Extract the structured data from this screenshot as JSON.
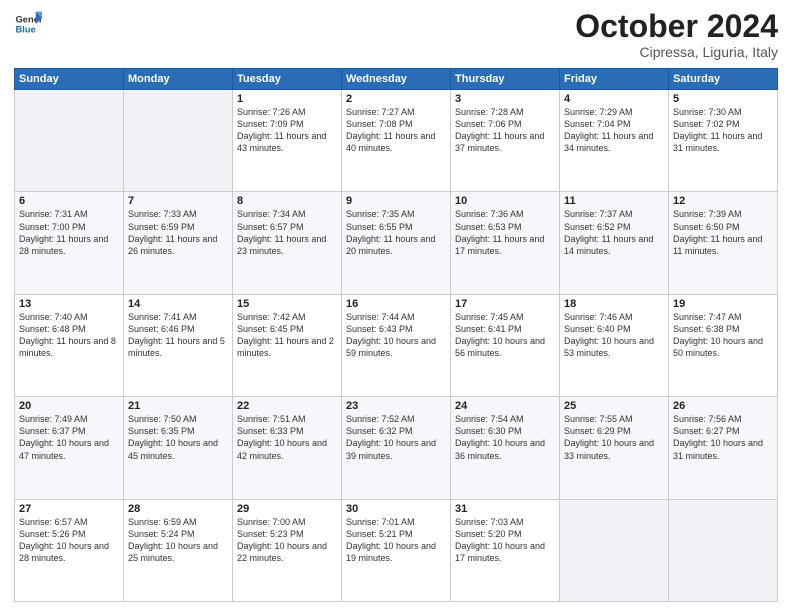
{
  "logo": {
    "line1": "General",
    "line2": "Blue"
  },
  "title": "October 2024",
  "subtitle": "Cipressa, Liguria, Italy",
  "header_days": [
    "Sunday",
    "Monday",
    "Tuesday",
    "Wednesday",
    "Thursday",
    "Friday",
    "Saturday"
  ],
  "weeks": [
    [
      {
        "day": "",
        "content": ""
      },
      {
        "day": "",
        "content": ""
      },
      {
        "day": "1",
        "content": "Sunrise: 7:26 AM\nSunset: 7:09 PM\nDaylight: 11 hours and 43 minutes."
      },
      {
        "day": "2",
        "content": "Sunrise: 7:27 AM\nSunset: 7:08 PM\nDaylight: 11 hours and 40 minutes."
      },
      {
        "day": "3",
        "content": "Sunrise: 7:28 AM\nSunset: 7:06 PM\nDaylight: 11 hours and 37 minutes."
      },
      {
        "day": "4",
        "content": "Sunrise: 7:29 AM\nSunset: 7:04 PM\nDaylight: 11 hours and 34 minutes."
      },
      {
        "day": "5",
        "content": "Sunrise: 7:30 AM\nSunset: 7:02 PM\nDaylight: 11 hours and 31 minutes."
      }
    ],
    [
      {
        "day": "6",
        "content": "Sunrise: 7:31 AM\nSunset: 7:00 PM\nDaylight: 11 hours and 28 minutes."
      },
      {
        "day": "7",
        "content": "Sunrise: 7:33 AM\nSunset: 6:59 PM\nDaylight: 11 hours and 26 minutes."
      },
      {
        "day": "8",
        "content": "Sunrise: 7:34 AM\nSunset: 6:57 PM\nDaylight: 11 hours and 23 minutes."
      },
      {
        "day": "9",
        "content": "Sunrise: 7:35 AM\nSunset: 6:55 PM\nDaylight: 11 hours and 20 minutes."
      },
      {
        "day": "10",
        "content": "Sunrise: 7:36 AM\nSunset: 6:53 PM\nDaylight: 11 hours and 17 minutes."
      },
      {
        "day": "11",
        "content": "Sunrise: 7:37 AM\nSunset: 6:52 PM\nDaylight: 11 hours and 14 minutes."
      },
      {
        "day": "12",
        "content": "Sunrise: 7:39 AM\nSunset: 6:50 PM\nDaylight: 11 hours and 11 minutes."
      }
    ],
    [
      {
        "day": "13",
        "content": "Sunrise: 7:40 AM\nSunset: 6:48 PM\nDaylight: 11 hours and 8 minutes."
      },
      {
        "day": "14",
        "content": "Sunrise: 7:41 AM\nSunset: 6:46 PM\nDaylight: 11 hours and 5 minutes."
      },
      {
        "day": "15",
        "content": "Sunrise: 7:42 AM\nSunset: 6:45 PM\nDaylight: 11 hours and 2 minutes."
      },
      {
        "day": "16",
        "content": "Sunrise: 7:44 AM\nSunset: 6:43 PM\nDaylight: 10 hours and 59 minutes."
      },
      {
        "day": "17",
        "content": "Sunrise: 7:45 AM\nSunset: 6:41 PM\nDaylight: 10 hours and 56 minutes."
      },
      {
        "day": "18",
        "content": "Sunrise: 7:46 AM\nSunset: 6:40 PM\nDaylight: 10 hours and 53 minutes."
      },
      {
        "day": "19",
        "content": "Sunrise: 7:47 AM\nSunset: 6:38 PM\nDaylight: 10 hours and 50 minutes."
      }
    ],
    [
      {
        "day": "20",
        "content": "Sunrise: 7:49 AM\nSunset: 6:37 PM\nDaylight: 10 hours and 47 minutes."
      },
      {
        "day": "21",
        "content": "Sunrise: 7:50 AM\nSunset: 6:35 PM\nDaylight: 10 hours and 45 minutes."
      },
      {
        "day": "22",
        "content": "Sunrise: 7:51 AM\nSunset: 6:33 PM\nDaylight: 10 hours and 42 minutes."
      },
      {
        "day": "23",
        "content": "Sunrise: 7:52 AM\nSunset: 6:32 PM\nDaylight: 10 hours and 39 minutes."
      },
      {
        "day": "24",
        "content": "Sunrise: 7:54 AM\nSunset: 6:30 PM\nDaylight: 10 hours and 36 minutes."
      },
      {
        "day": "25",
        "content": "Sunrise: 7:55 AM\nSunset: 6:29 PM\nDaylight: 10 hours and 33 minutes."
      },
      {
        "day": "26",
        "content": "Sunrise: 7:56 AM\nSunset: 6:27 PM\nDaylight: 10 hours and 31 minutes."
      }
    ],
    [
      {
        "day": "27",
        "content": "Sunrise: 6:57 AM\nSunset: 5:26 PM\nDaylight: 10 hours and 28 minutes."
      },
      {
        "day": "28",
        "content": "Sunrise: 6:59 AM\nSunset: 5:24 PM\nDaylight: 10 hours and 25 minutes."
      },
      {
        "day": "29",
        "content": "Sunrise: 7:00 AM\nSunset: 5:23 PM\nDaylight: 10 hours and 22 minutes."
      },
      {
        "day": "30",
        "content": "Sunrise: 7:01 AM\nSunset: 5:21 PM\nDaylight: 10 hours and 19 minutes."
      },
      {
        "day": "31",
        "content": "Sunrise: 7:03 AM\nSunset: 5:20 PM\nDaylight: 10 hours and 17 minutes."
      },
      {
        "day": "",
        "content": ""
      },
      {
        "day": "",
        "content": ""
      }
    ]
  ]
}
